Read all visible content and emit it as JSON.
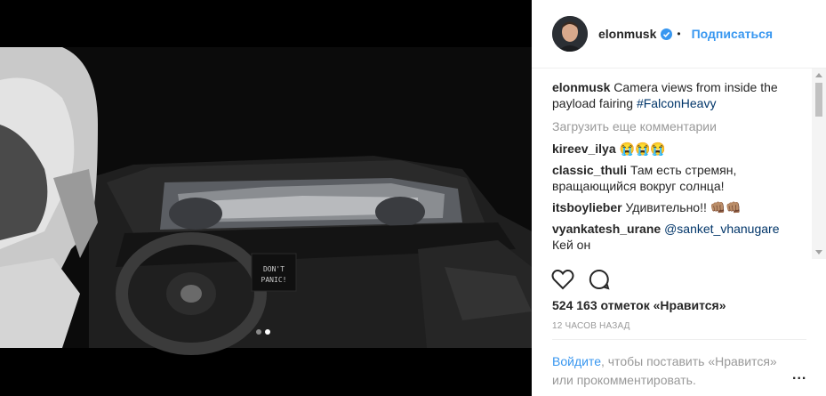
{
  "post": {
    "username": "elonmusk",
    "follow_label": "Подписаться",
    "bullet": "•",
    "caption": "Camera views from inside the payload fairing",
    "caption_tag": "#FalconHeavy",
    "load_more": "Загрузить еще комментарии",
    "likes": "524 163 отметок «Нравится»",
    "time_ago": "12 ЧАСОВ НАЗАД",
    "login_link": "Войдите",
    "login_rest": ", чтобы поставить «Нравится» или прокомментировать.",
    "more_label": "..."
  },
  "media": {
    "sign_line1": "DON'T",
    "sign_line2": "PANIC!",
    "slide_count": 2,
    "active_slide": 2
  },
  "comments": [
    {
      "user": "kireev_ilya",
      "text": "😭😭😭"
    },
    {
      "user": "classic_thuli",
      "text": "Там есть стремян, вращающийся вокруг солнца!"
    },
    {
      "user": "itsboylieber",
      "text": "Удивительно!! 👊🏽👊🏽"
    },
    {
      "user": "vyankatesh_urane",
      "mention": "@sanket_vhanugare",
      "text": "Кей он"
    }
  ],
  "colors": {
    "link": "#3897f0",
    "tag": "#003569",
    "muted": "#999999",
    "text": "#262626"
  },
  "icons": [
    "verified-badge-icon",
    "heart-icon",
    "comment-icon",
    "more-options-icon"
  ]
}
